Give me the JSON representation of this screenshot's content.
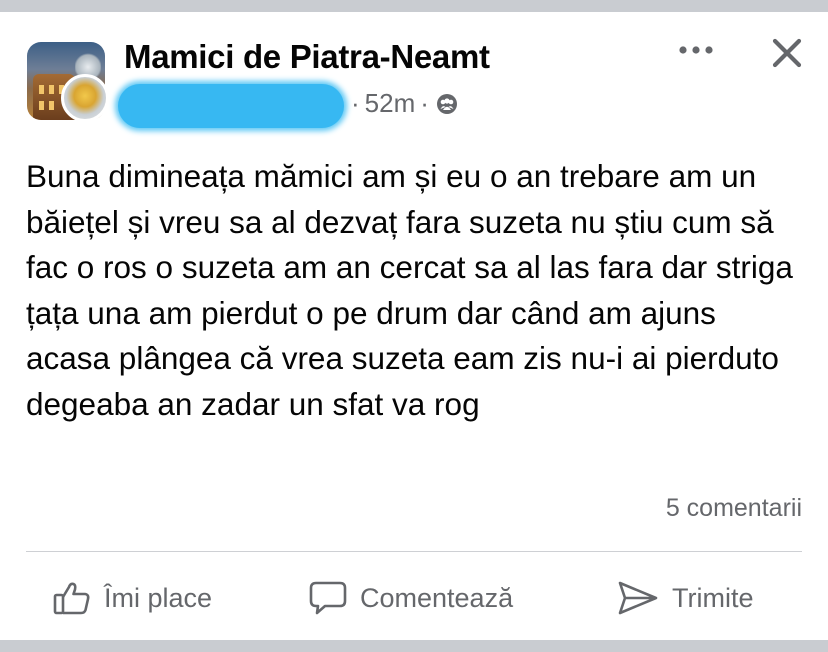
{
  "post": {
    "group_name": "Mamici de Piatra-Neamt",
    "time": "52m",
    "separator": "·",
    "audience_icon": "group-audience-icon",
    "text": "Buna dimineața mămici am și eu o an trebare am un băiețel și vreu sa al dezvaț fara suzeta nu știu cum să fac o ros o suzeta am an cercat sa al las fara dar striga țața una am pierdut o pe drum dar când am ajuns acasa plângea că vrea suzeta eam zis nu-i ai pierduto degeaba an zadar un sfat va rog",
    "comments_count": "5 comentarii"
  },
  "header_icons": {
    "more": "more-options-icon",
    "close": "close-icon"
  },
  "actions": {
    "like_label": "Îmi place",
    "comment_label": "Comentează",
    "share_label": "Trimite"
  },
  "colors": {
    "text": "#050505",
    "secondary_text": "#65676b",
    "divider": "#ced0d4",
    "redaction": "#37b8f2",
    "chrome_bar": "#c9ccd1"
  }
}
